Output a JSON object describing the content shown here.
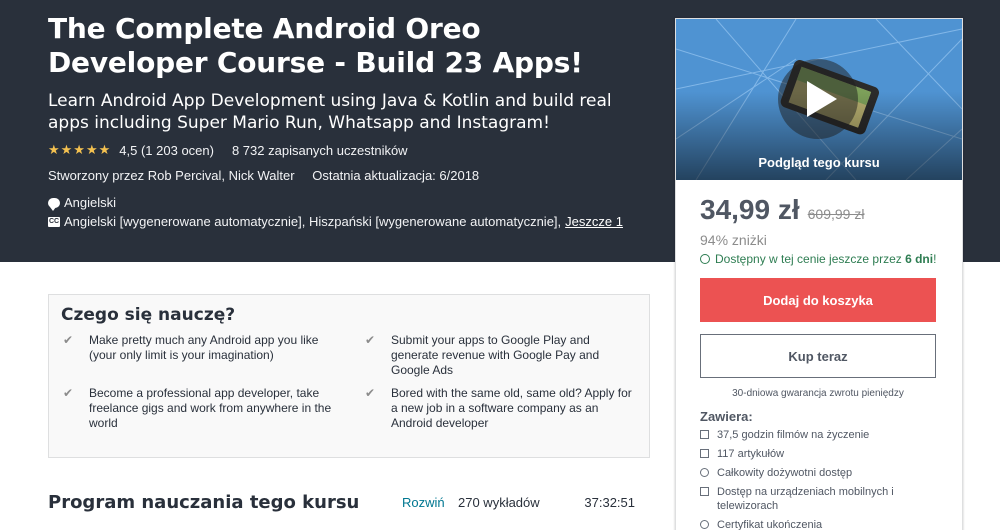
{
  "hero": {
    "title": "The Complete Android Oreo Developer Course - Build 23 Apps!",
    "subtitle": "Learn Android App Development using Java & Kotlin and build real apps including Super Mario Run, Whatsapp and Instagram!",
    "stars": "★★★★★",
    "rating_value": 4.5,
    "rating_text": "4,5 (1 203 ocen)",
    "students": "8 732 zapisanych uczestników",
    "created_by": "Stworzony przez Rob Percival, Nick Walter",
    "last_update": "Ostatnia aktualizacja: 6/2018",
    "language": "Angielski",
    "captions": "Angielski [wygenerowane automatycznie], Hiszpański [wygenerowane automatycznie],",
    "captions_more": "Jeszcze 1",
    "colors": {
      "background": "#29303b",
      "stars": "#f4c150"
    }
  },
  "sidebar": {
    "preview_label": "Podgląd tego kursu",
    "price": "34,99 zł",
    "original_price": "609,99 zł",
    "discount": "94% zniżki",
    "offer_prefix": "Dostępny w tej cenie jeszcze przez ",
    "offer_days": "6 dni",
    "offer_suffix": "!",
    "add_to_cart": "Dodaj do koszyka",
    "buy_now": "Kup teraz",
    "guarantee": "30-dniowa gwarancja zwrotu pieniędzy",
    "includes_title": "Zawiera:",
    "includes": [
      {
        "icon": "video-icon",
        "text": "37,5 godzin filmów na życzenie"
      },
      {
        "icon": "article-icon",
        "text": "117 artykułów"
      },
      {
        "icon": "infinity-icon",
        "text": "Całkowity dożywotni dostęp"
      },
      {
        "icon": "mobile-icon",
        "text": "Dostęp na urządzeniach mobilnych i telewizorach"
      },
      {
        "icon": "certificate-icon",
        "text": "Certyfikat ukończenia"
      }
    ],
    "colors": {
      "cart_button": "#ec5252",
      "offer": "#2e7d52"
    }
  },
  "learn": {
    "title": "Czego się nauczę?",
    "items": [
      "Make pretty much any Android app you like (your only limit is your imagination)",
      "Submit your apps to Google Play and generate revenue with Google Pay and Google Ads",
      "Become a professional app developer, take freelance gigs and work from anywhere in the world",
      "Bored with the same old, same old? Apply for a new job in a software company as an Android developer"
    ]
  },
  "curriculum": {
    "title": "Program nauczania tego kursu",
    "expand": "Rozwiń",
    "lectures": "270 wykładów",
    "duration": "37:32:51"
  }
}
